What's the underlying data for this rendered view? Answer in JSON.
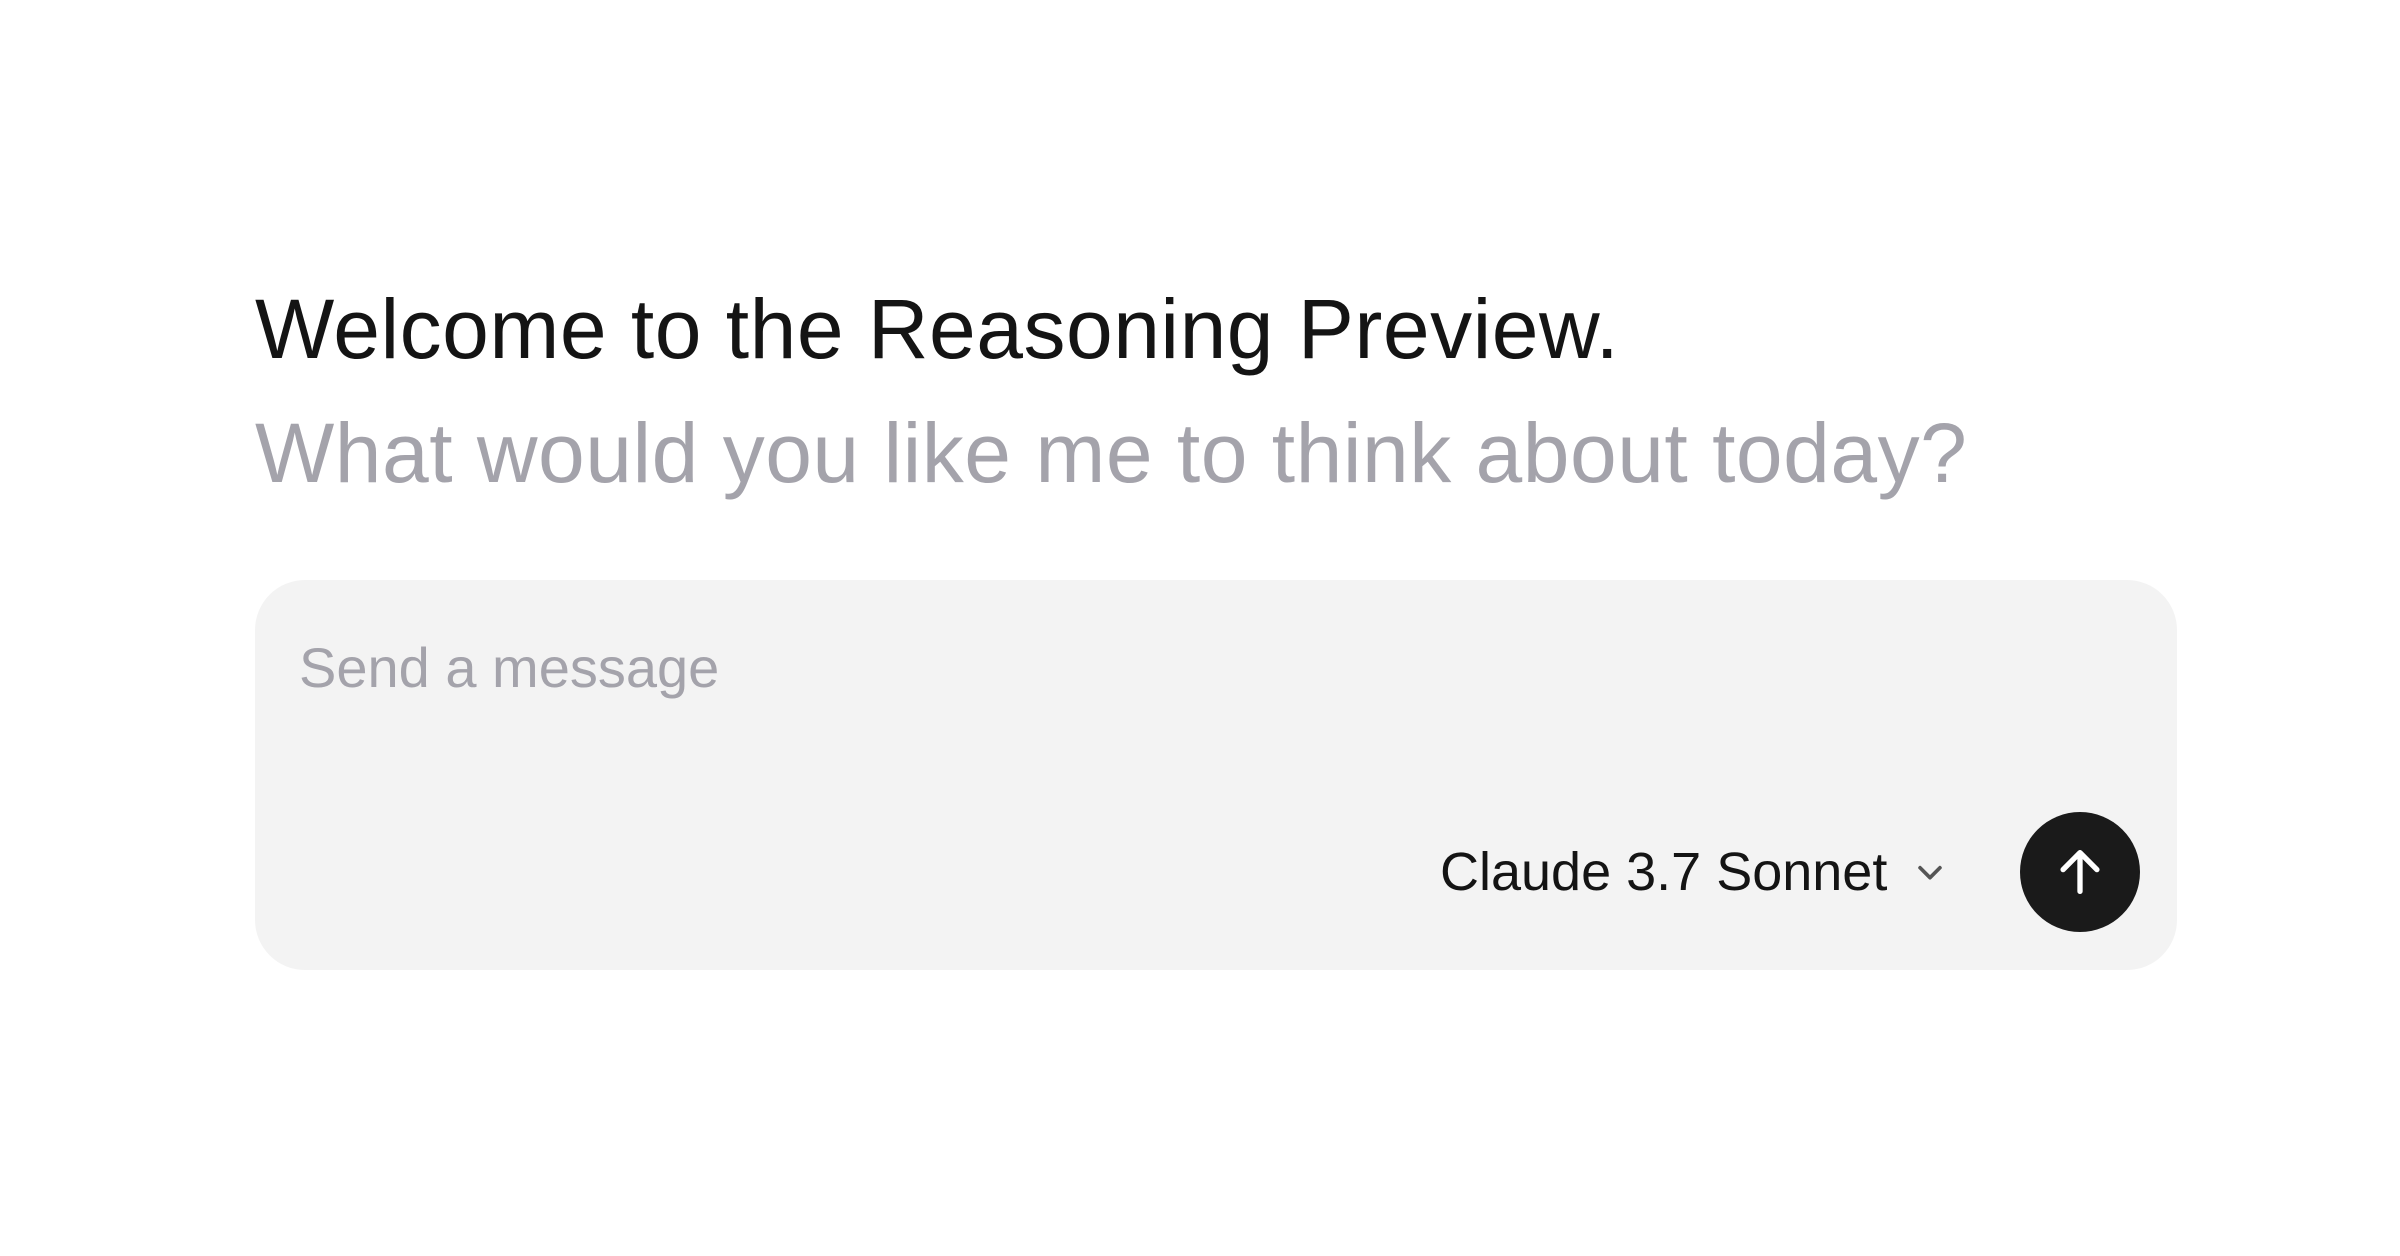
{
  "header": {
    "title": "Welcome to the Reasoning Preview.",
    "subtitle": "What would you like me to think about today?"
  },
  "composer": {
    "placeholder": "Send a message",
    "value": "",
    "model_selector": {
      "selected": "Claude 3.7 Sonnet",
      "icon": "chevron-down-icon"
    },
    "send_button": {
      "icon": "arrow-up-icon"
    }
  },
  "colors": {
    "title": "#141414",
    "subtitle": "#a4a3ab",
    "composer_background": "#f3f3f3",
    "send_button": "#1a1a1a",
    "send_icon": "#ffffff"
  }
}
